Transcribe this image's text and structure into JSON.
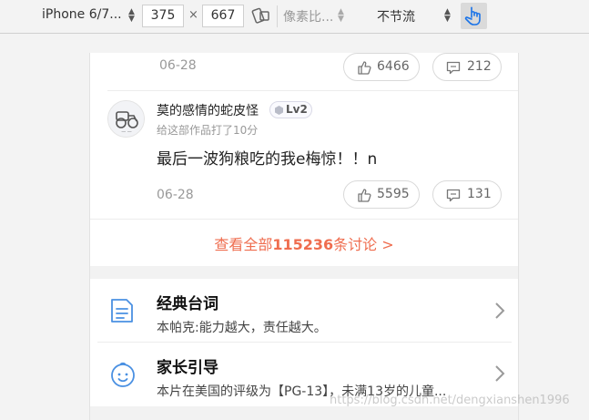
{
  "toolbar": {
    "device": "iPhone 6/7...",
    "width": "375",
    "times": "×",
    "height": "667",
    "dpr": "像素比...",
    "throttle": "不节流"
  },
  "comments": [
    {
      "date": "06-28",
      "likes": "6466",
      "replies": "212"
    },
    {
      "username": "莫的感情的蛇皮怪",
      "level": "Lv2",
      "rating_text": "给这部作品打了10分",
      "text": "最后一波狗粮吃的我e梅惊！！n",
      "date": "06-28",
      "likes": "5595",
      "replies": "131"
    }
  ],
  "see_all": {
    "prefix": "查看全部",
    "count": "115236",
    "suffix": "条讨论 >"
  },
  "info_rows": [
    {
      "title": "经典台词",
      "desc": "本帕克:能力越大，责任越大。",
      "icon": "document-icon"
    },
    {
      "title": "家长引导",
      "desc": "本片在美国的评级为【PG-13】，未满13岁的儿童...",
      "icon": "baby-face-icon"
    }
  ],
  "watermark": "https://blog.csdn.net/dengxianshen1996",
  "colors": {
    "accent": "#ef6d4f",
    "icon_blue": "#4a90e2",
    "touch_active": "#1a73e8"
  }
}
